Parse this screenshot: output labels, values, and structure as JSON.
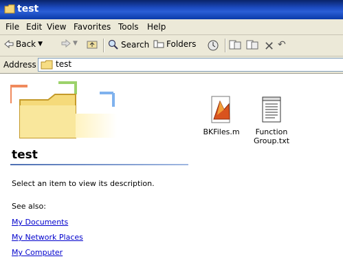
{
  "window": {
    "title": "test"
  },
  "menu": [
    "File",
    "Edit",
    "View",
    "Favorites",
    "Tools",
    "Help"
  ],
  "toolbar": {
    "back_label": "Back",
    "search_label": "Search",
    "folders_label": "Folders"
  },
  "address": {
    "label": "Address",
    "value": "test"
  },
  "left_panel": {
    "title": "test",
    "description": "Select an item to view its description.",
    "see_also_label": "See also:",
    "links": [
      "My Documents",
      "My Network Places",
      "My Computer"
    ]
  },
  "files": [
    {
      "name": "BKFiles.m",
      "icon": "matlab-file-icon"
    },
    {
      "name": "Function Group.txt",
      "icon": "text-file-icon"
    }
  ],
  "colors": {
    "titlebar": "#0a246a",
    "link": "#0000cc",
    "chrome": "#ece9d8"
  }
}
